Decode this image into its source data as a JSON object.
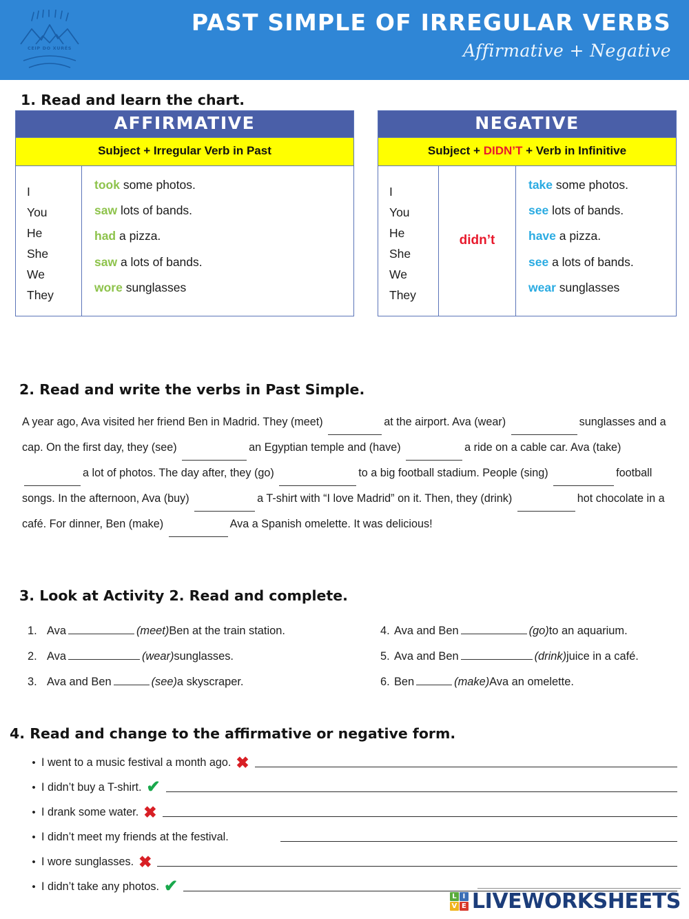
{
  "header": {
    "title": "PAST SIMPLE OF IRREGULAR VERBS",
    "subtitle": "Affirmative + Negative",
    "logo_text": "CEIP DO XURÉS",
    "banner_color": "#2f86d6"
  },
  "activity1": {
    "heading": "1. Read and learn the chart.",
    "affirmative": {
      "title": "AFFIRMATIVE",
      "formula_prefix": "Subject + Irregular Verb in Past",
      "subjects": "I\nYou\nHe\nShe\nWe\nThey",
      "rows": [
        {
          "verb": "took",
          "rest": " some photos."
        },
        {
          "verb": "saw",
          "rest": " lots of bands."
        },
        {
          "verb": "had",
          "rest": " a pizza."
        },
        {
          "verb": "saw",
          "rest": " a lots of bands."
        },
        {
          "verb": "wore",
          "rest": " sunglasses"
        }
      ],
      "verb_color": "#8ec34c"
    },
    "negative": {
      "title": "NEGATIVE",
      "formula_a": "Subject + ",
      "formula_didnt": "DIDN’T",
      "formula_b": " + Verb in Infinitive",
      "subjects": "I\nYou\nHe\nShe\nWe\nThey",
      "aux": "didn’t",
      "rows": [
        {
          "verb": "take",
          "rest": " some photos."
        },
        {
          "verb": "see",
          "rest": " lots of bands."
        },
        {
          "verb": "have",
          "rest": " a pizza."
        },
        {
          "verb": "see",
          "rest": " a lots of bands."
        },
        {
          "verb": "wear",
          "rest": " sunglasses"
        }
      ],
      "verb_color": "#2aabe2",
      "aux_color": "#e8192c"
    }
  },
  "activity2": {
    "heading": "2. Read and write the verbs in Past Simple.",
    "segments": [
      {
        "t": "A year ago, Ava visited her friend Ben in Madrid. They (meet)"
      },
      {
        "blank": 78
      },
      {
        "t": "at the airport. Ava (wear)"
      },
      {
        "blank": 96
      },
      {
        "t": "sunglasses and a cap.  On the first day, they (see)"
      },
      {
        "blank": 94
      },
      {
        "t": "an Egyptian temple and (have)"
      },
      {
        "blank": 82
      },
      {
        "t": "a ride on a cable car. Ava (take)"
      },
      {
        "blank": 82
      },
      {
        "t": "a lot of photos. The day after, they  (go)"
      },
      {
        "blank": 112
      },
      {
        "t": "to a big football stadium. People (sing)"
      },
      {
        "blank": 88
      },
      {
        "t": "football songs. In the afternoon, Ava (buy)"
      },
      {
        "blank": 88
      },
      {
        "t": "a T-shirt with “I love Madrid” on it. Then, they (drink)"
      },
      {
        "blank": 84
      },
      {
        "t": "hot chocolate in a café. For dinner, Ben (make)"
      },
      {
        "blank": 86
      },
      {
        "t": "Ava a Spanish omelette. It was delicious!"
      }
    ]
  },
  "activity3": {
    "heading": "3. Look at Activity 2. Read and complete.",
    "left_items": [
      {
        "num": "1.",
        "pre": "Ava",
        "blank": 96,
        "cue": "(meet)",
        "post": "Ben at the train station."
      },
      {
        "num": "2.",
        "pre": "Ava",
        "blank": 104,
        "cue": "(wear)",
        "post": "sunglasses."
      },
      {
        "num": "3.",
        "pre": "Ava and Ben",
        "blank": 52,
        "cue": "(see)",
        "post": "a skyscraper."
      }
    ],
    "right_items": [
      {
        "num": "4.",
        "pre": "Ava and Ben",
        "blank": 96,
        "cue": "(go)",
        "post": "to an aquarium."
      },
      {
        "num": "5.",
        "pre": "Ava and Ben",
        "blank": 104,
        "cue": "(drink)",
        "post": "juice in a café."
      },
      {
        "num": "6.",
        "pre": "Ben",
        "blank": 52,
        "cue": "(make)",
        "post": "Ava an omelette."
      }
    ]
  },
  "activity4": {
    "heading": "4. Read and change to the affirmative or negative form.",
    "items": [
      {
        "text": "I went to a music festival a month ago.",
        "mark": "cross"
      },
      {
        "text": "I didn’t buy a T-shirt.",
        "mark": "check"
      },
      {
        "text": "I drank some water.",
        "mark": "cross"
      },
      {
        "text": "I didn’t meet my friends at the festival.",
        "mark": "none"
      },
      {
        "text": "I wore sunglasses.",
        "mark": "cross"
      },
      {
        "text": "I didn’t take any photos.",
        "mark": "check"
      }
    ],
    "cross_glyph": "✖",
    "check_glyph": "✔",
    "cross_color": "#d81f25",
    "check_color": "#19a84c"
  },
  "footer": {
    "brand": "LIVEWORKSHEETS",
    "squares": [
      {
        "letter": "L",
        "color": "#5aab3c"
      },
      {
        "letter": "I",
        "color": "#3b6fb5"
      },
      {
        "letter": "V",
        "color": "#f0b41c"
      },
      {
        "letter": "E",
        "color": "#d8392b"
      }
    ]
  }
}
